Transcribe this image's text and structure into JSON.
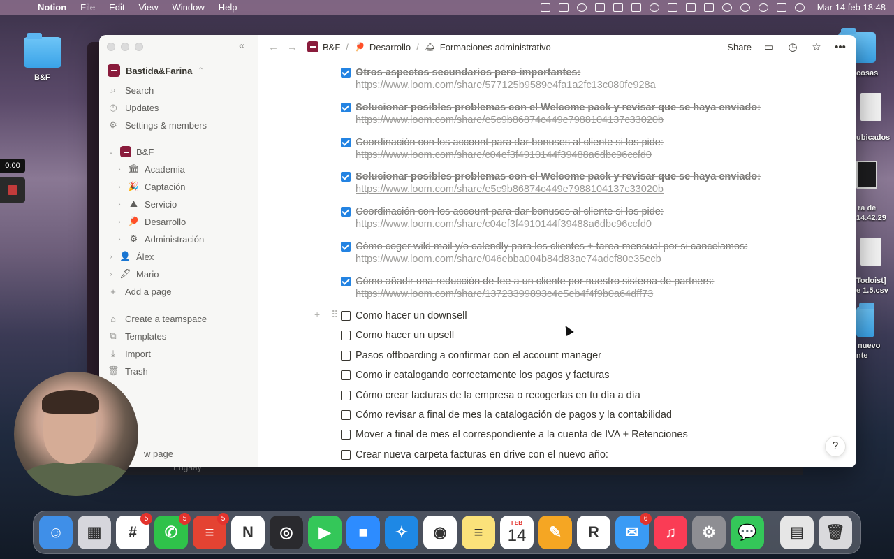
{
  "menubar": {
    "app_name": "Notion",
    "menus": [
      "File",
      "Edit",
      "View",
      "Window",
      "Help"
    ],
    "datetime": "Mar 14 feb 18:48"
  },
  "desktop": {
    "folder_label": "B&F",
    "right_labels": [
      "cosas",
      "ubicados",
      "ra de",
      "14.42.29",
      "Todoist]",
      "e 1.5.csv",
      "nuevo",
      "nte"
    ],
    "timer": "0:00",
    "behind_text": "Engaay"
  },
  "sidebar": {
    "workspace_name": "Bastida&Farina",
    "top_items": [
      {
        "label": "Search",
        "icon": "search-icon"
      },
      {
        "label": "Updates",
        "icon": "clock-icon"
      },
      {
        "label": "Settings & members",
        "icon": "gear-icon"
      }
    ],
    "teamspace": {
      "name": "B&F",
      "children": [
        {
          "label": "Academia",
          "emoji": "🏛"
        },
        {
          "label": "Captación",
          "emoji": "🎉"
        },
        {
          "label": "Servicio",
          "emoji": "⛰"
        },
        {
          "label": "Desarrollo",
          "emoji": "🏓"
        },
        {
          "label": "Administración",
          "emoji": "⚙"
        }
      ]
    },
    "people": [
      {
        "label": "Álex",
        "emoji": "👤"
      },
      {
        "label": "Mario",
        "emoji": "🖋"
      }
    ],
    "add_page": "Add a page",
    "bottom_items": [
      {
        "label": "Create a teamspace",
        "icon": "teamspace-icon"
      },
      {
        "label": "Templates",
        "icon": "templates-icon"
      },
      {
        "label": "Import",
        "icon": "import-icon"
      },
      {
        "label": "Trash",
        "icon": "trash-icon"
      }
    ],
    "new_page": "w page"
  },
  "topbar": {
    "breadcrumbs": [
      {
        "label": "B&F",
        "icon": "logo"
      },
      {
        "label": "Desarrollo",
        "icon": "🏓"
      },
      {
        "label": "Formaciones administrativo",
        "icon": "🛎"
      }
    ],
    "share_label": "Share"
  },
  "todos": [
    {
      "text": "Otros aspectos secundarios pero importantes:",
      "link": "https://www.loom.com/share/577125b9589e4fa1a2fc13c080fe928a",
      "checked": true,
      "bold": true
    },
    {
      "text": "Solucionar posibles problemas con el Welcome pack y revisar que se haya enviado:",
      "link": "https://www.loom.com/share/e5c9b86874c449e7988104137c33020b",
      "checked": true,
      "bold": true
    },
    {
      "text": "Coordinación con los account para dar bonuses al cliente si los pide:",
      "link": "https://www.loom.com/share/c04ef3f4910144f39488a6dbc96ccfd0",
      "checked": true,
      "bold": false
    },
    {
      "text": "Solucionar posibles problemas con el Welcome pack y revisar que se haya enviado:",
      "link": "https://www.loom.com/share/e5c9b86874c449e7988104137c33020b",
      "checked": true,
      "bold": true
    },
    {
      "text": "Coordinación con los account para dar bonuses al cliente si los pide:",
      "link": "https://www.loom.com/share/c04ef3f4910144f39488a6dbc96ccfd0",
      "checked": true,
      "bold": false
    },
    {
      "text": "Cómo coger wild mail y/o calendly para los clientes + tarea mensual por si cancelamos:",
      "link": "https://www.loom.com/share/046ebba004b84d83ae74adcf80e35ecb",
      "checked": true,
      "bold": false
    },
    {
      "text": "Cómo añadir una reducción de fee a un cliente por nuestro sistema de partners:",
      "link": "https://www.loom.com/share/13723399893c4e5eb4f4f9b0a64dff73",
      "checked": true,
      "bold": false
    },
    {
      "text": "Como hacer un downsell",
      "checked": false
    },
    {
      "text": "Como hacer un upsell",
      "checked": false
    },
    {
      "text": "Pasos offboarding a confirmar con el account manager",
      "checked": false
    },
    {
      "text": "Como ir catalogando correctamente los pagos y facturas",
      "checked": false
    },
    {
      "text": "Cómo crear facturas de la empresa o recogerlas en tu día a día",
      "checked": false
    },
    {
      "text": "Cómo revisar a final de mes la catalogación de pagos y la contabilidad",
      "checked": false
    },
    {
      "text": "Mover a final de mes el correspondiente a la cuenta de IVA + Retenciones",
      "checked": false
    },
    {
      "text": "Crear nueva carpeta facturas en drive con el nuevo año:",
      "checked": false
    }
  ],
  "help_label": "?",
  "dock": {
    "apps": [
      {
        "name": "finder",
        "color": "#3f8fe8",
        "glyph": "☺"
      },
      {
        "name": "launchpad",
        "color": "#d6d6dc",
        "glyph": "▦"
      },
      {
        "name": "slack",
        "color": "#ffffff",
        "glyph": "#",
        "badge": "5"
      },
      {
        "name": "whatsapp",
        "color": "#2fc24a",
        "glyph": "✆",
        "badge": "5"
      },
      {
        "name": "todoist",
        "color": "#e44332",
        "glyph": "≡",
        "badge": "5"
      },
      {
        "name": "notion",
        "color": "#ffffff",
        "glyph": "N"
      },
      {
        "name": "obs",
        "color": "#2a2a2e",
        "glyph": "◎"
      },
      {
        "name": "facetime",
        "color": "#34c759",
        "glyph": "▶"
      },
      {
        "name": "zoom",
        "color": "#2d8cff",
        "glyph": "■"
      },
      {
        "name": "safari",
        "color": "#1e88e5",
        "glyph": "✧"
      },
      {
        "name": "chrome",
        "color": "#ffffff",
        "glyph": "◉"
      },
      {
        "name": "notes",
        "color": "#fbe27a",
        "glyph": "≡"
      },
      {
        "name": "calendar",
        "color": "#ffffff",
        "glyph": "",
        "month": "FEB",
        "day": "14"
      },
      {
        "name": "pages",
        "color": "#f5a623",
        "glyph": "✎"
      },
      {
        "name": "readdle",
        "color": "#ffffff",
        "glyph": "R"
      },
      {
        "name": "mail",
        "color": "#3a9bf5",
        "glyph": "✉",
        "badge": "6"
      },
      {
        "name": "music",
        "color": "#fa3c55",
        "glyph": "♫"
      },
      {
        "name": "system-preferences",
        "color": "#8e8e93",
        "glyph": "⚙"
      },
      {
        "name": "messages",
        "color": "#34c759",
        "glyph": "💬"
      }
    ],
    "right": [
      {
        "name": "downloads-stack",
        "color": "#e6e6e6",
        "glyph": "▤"
      },
      {
        "name": "trash",
        "color": "#d9d9dc",
        "glyph": "🗑"
      }
    ]
  }
}
